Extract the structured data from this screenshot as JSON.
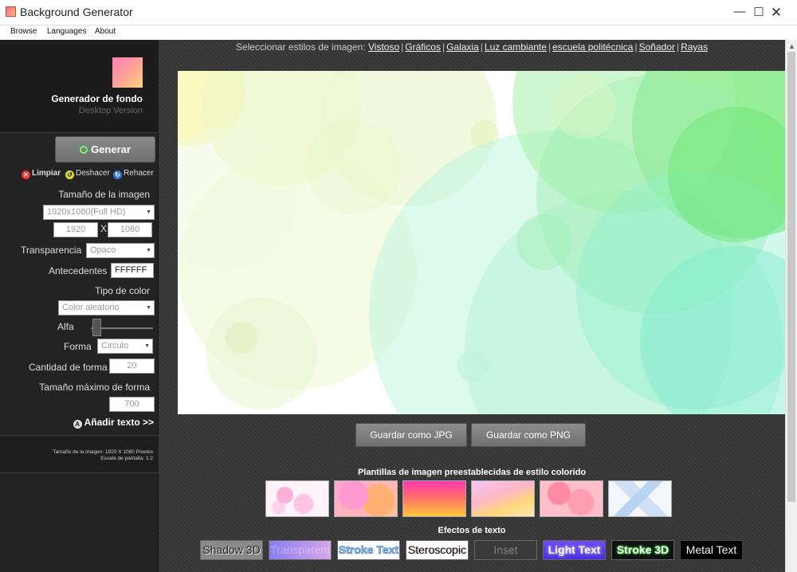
{
  "window": {
    "title": "Background Generator",
    "minimize": "—",
    "maximize": "☐",
    "close": "✕"
  },
  "menu": [
    "Browse",
    "Languages",
    "About"
  ],
  "sidebar": {
    "app_title": "Generador de fondo",
    "app_subtitle": "Desktop Version",
    "generate": "Generar",
    "clear": "Limpiar",
    "undo": "Deshacer",
    "redo": "Rehacer",
    "image_size_label": "Tamaño de la imagen",
    "image_size_value": "1920x1080(Full HD)",
    "width": "1920",
    "x_sep": "X",
    "height": "1080",
    "transparency_label": "Transparencia",
    "transparency_value": "Opaco",
    "background_label": "Antecedentes",
    "background_value": "FFFFFF",
    "color_type_label": "Tipo de color",
    "color_type_value": "Color aleatorio",
    "alpha_label": "Alfa",
    "alpha_level": 0.1,
    "shape_label": "Forma",
    "shape_value": "Circulo",
    "shape_count_label": "Cantidad de forma",
    "shape_count_value": "20",
    "max_shape_size_label": "Tamaño máximo de forma",
    "max_shape_size_value": "700",
    "add_text": "Añadir texto >>",
    "info_size": "Tamaño de la imagen: 1920 X 1080 Píxeles",
    "info_scale": "Escala de pantalla: 1:2"
  },
  "main": {
    "styles_prefix": "Seleccionar estilos de imagen:",
    "styles": [
      "Vistoso",
      "Gráficos",
      "Galaxia",
      "Luz cambiante",
      "escuela politécnica",
      "Soñador",
      "Rayas"
    ],
    "save_jpg": "Guardar como JPG",
    "save_png": "Guardar como PNG",
    "templates_title": "Plantillas de imagen preestablecidas de estilo colorido",
    "text_effects_title": "Efectos de texto",
    "text_effects": [
      "Shadow 3D",
      "Transparent",
      "Stroke Text",
      "Steroscopic",
      "Inset",
      "Light Text",
      "Stroke 3D",
      "Metal Text"
    ]
  }
}
